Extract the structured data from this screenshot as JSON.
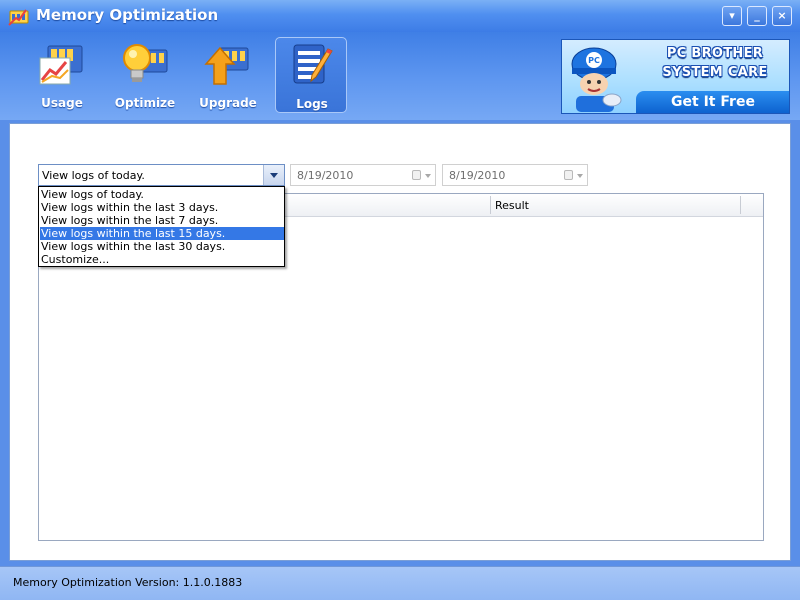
{
  "window": {
    "title": "Memory Optimization",
    "buttons": {
      "menu": "▾",
      "minimize": "_",
      "close": "×"
    }
  },
  "toolbar": {
    "items": [
      {
        "label": "Usage",
        "icon": "usage-chart-icon"
      },
      {
        "label": "Optimize",
        "icon": "lightbulb-icon"
      },
      {
        "label": "Upgrade",
        "icon": "upgrade-arrow-icon"
      },
      {
        "label": "Logs",
        "icon": "notepad-pencil-icon",
        "active": true
      }
    ]
  },
  "ad": {
    "line1": "PC BROTHER",
    "line2": "SYSTEM CARE",
    "cta": "Get It Free",
    "mascot_badge": "PC"
  },
  "filter": {
    "selected": "View logs of today.",
    "options": [
      "View logs of today.",
      "View logs within the last 3 days.",
      "View logs within the last 7 days.",
      "View logs within the last 15 days.",
      "View logs within the last 30 days.",
      "Customize..."
    ],
    "highlighted_index": 3
  },
  "dates": {
    "start": "8/19/2010",
    "end": "8/19/2010"
  },
  "grid": {
    "columns": [
      "",
      "Result"
    ]
  },
  "status": {
    "text": "Memory Optimization Version: 1.1.0.1883"
  },
  "colors": {
    "titlebar": "#4f8ff0",
    "toolbar": "#5f97f0",
    "selection": "#3478e6",
    "status_bar": "#a6c6f7"
  }
}
